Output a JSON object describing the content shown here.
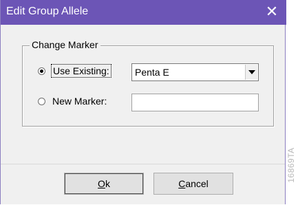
{
  "window": {
    "title": "Edit Group Allele",
    "close_glyph": "✕",
    "title_bar_color": "#6c55b6"
  },
  "group": {
    "legend": "Change Marker",
    "use_existing": {
      "label": "Use Existing:",
      "selected": true,
      "combo_value": "Penta E"
    },
    "new_marker": {
      "label": "New Marker:",
      "selected": false,
      "value": ""
    }
  },
  "buttons": {
    "ok_label": "Ok",
    "cancel_label": "Cancel"
  },
  "watermark": "16869TA"
}
